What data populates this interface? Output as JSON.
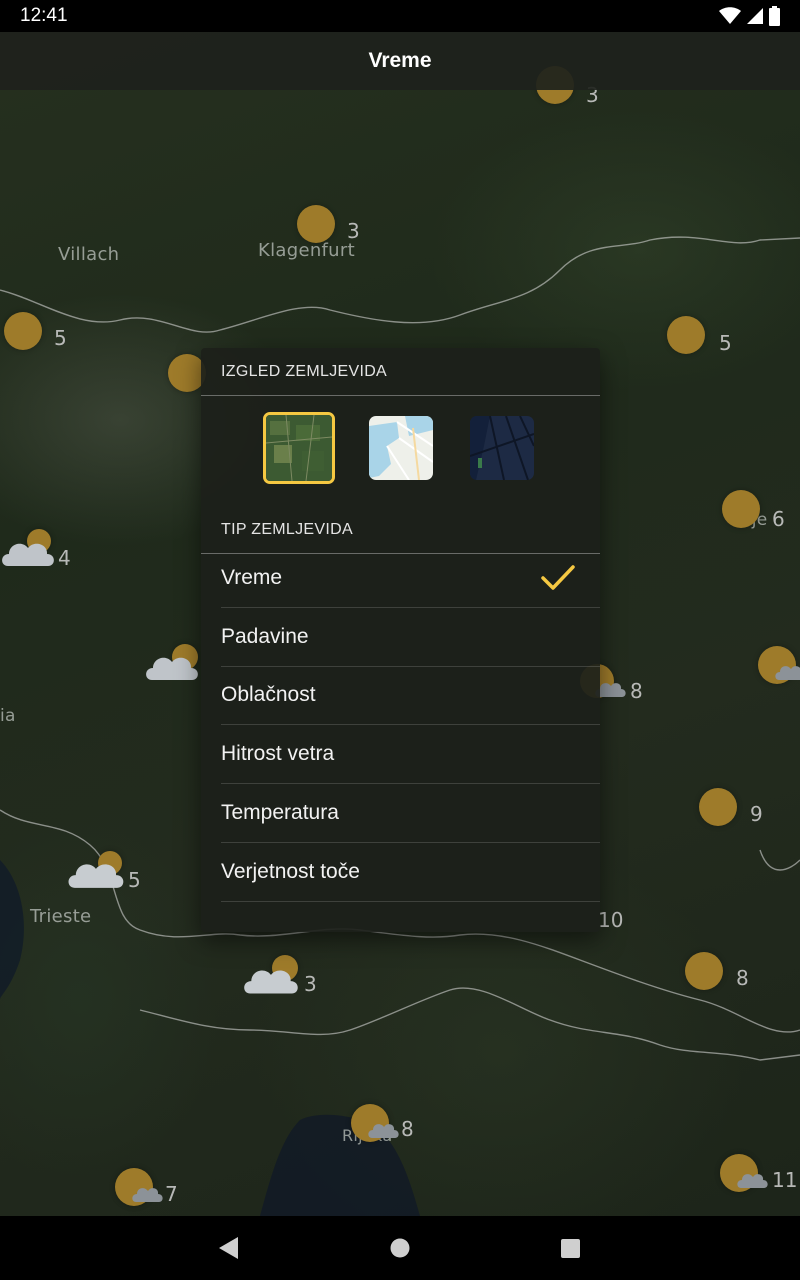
{
  "status_bar": {
    "time": "12:41",
    "icons": [
      "wifi-icon",
      "signal-icon",
      "battery-icon"
    ]
  },
  "app_bar": {
    "title": "Vreme"
  },
  "map": {
    "cities": [
      "Villach",
      "Klagenfurt",
      "Trieste",
      "Rijeka",
      "elje",
      "ia"
    ],
    "markers": [
      {
        "temp": "3",
        "condition": "sunny"
      },
      {
        "temp": "3",
        "condition": "sunny"
      },
      {
        "temp": "5",
        "condition": "sunny"
      },
      {
        "temp": "5",
        "condition": "sunny"
      },
      {
        "temp": "6",
        "condition": "sunny"
      },
      {
        "temp": "4",
        "condition": "partly-cloudy"
      },
      {
        "temp": "8",
        "condition": "partly-cloudy"
      },
      {
        "temp": "9",
        "condition": "sunny"
      },
      {
        "temp": "5",
        "condition": "partly-cloudy"
      },
      {
        "temp": "10",
        "condition": "sunny"
      },
      {
        "temp": "3",
        "condition": "partly-cloudy"
      },
      {
        "temp": "8",
        "condition": "sunny"
      },
      {
        "temp": "8",
        "condition": "partly-cloudy"
      },
      {
        "temp": "7",
        "condition": "partly-cloudy"
      },
      {
        "temp": "11",
        "condition": "partly-cloudy"
      }
    ]
  },
  "dialog": {
    "appearance_header": "IZGLED ZEMLJEVIDA",
    "appearance_options": [
      {
        "name": "satellite",
        "selected": true
      },
      {
        "name": "light",
        "selected": false
      },
      {
        "name": "dark",
        "selected": false
      }
    ],
    "type_header": "TIP ZEMLJEVIDA",
    "map_types": [
      {
        "label": "Vreme",
        "selected": true
      },
      {
        "label": "Padavine",
        "selected": false
      },
      {
        "label": "Oblačnost",
        "selected": false
      },
      {
        "label": "Hitrost vetra",
        "selected": false
      },
      {
        "label": "Temperatura",
        "selected": false
      },
      {
        "label": "Verjetnost toče",
        "selected": false
      }
    ]
  },
  "colors": {
    "accent": "#f5c842",
    "sun": "#9e7b2a",
    "dialog_bg": "#1c1f1a"
  },
  "nav_bar": {
    "buttons": [
      "back-icon",
      "home-icon",
      "recents-icon"
    ]
  }
}
